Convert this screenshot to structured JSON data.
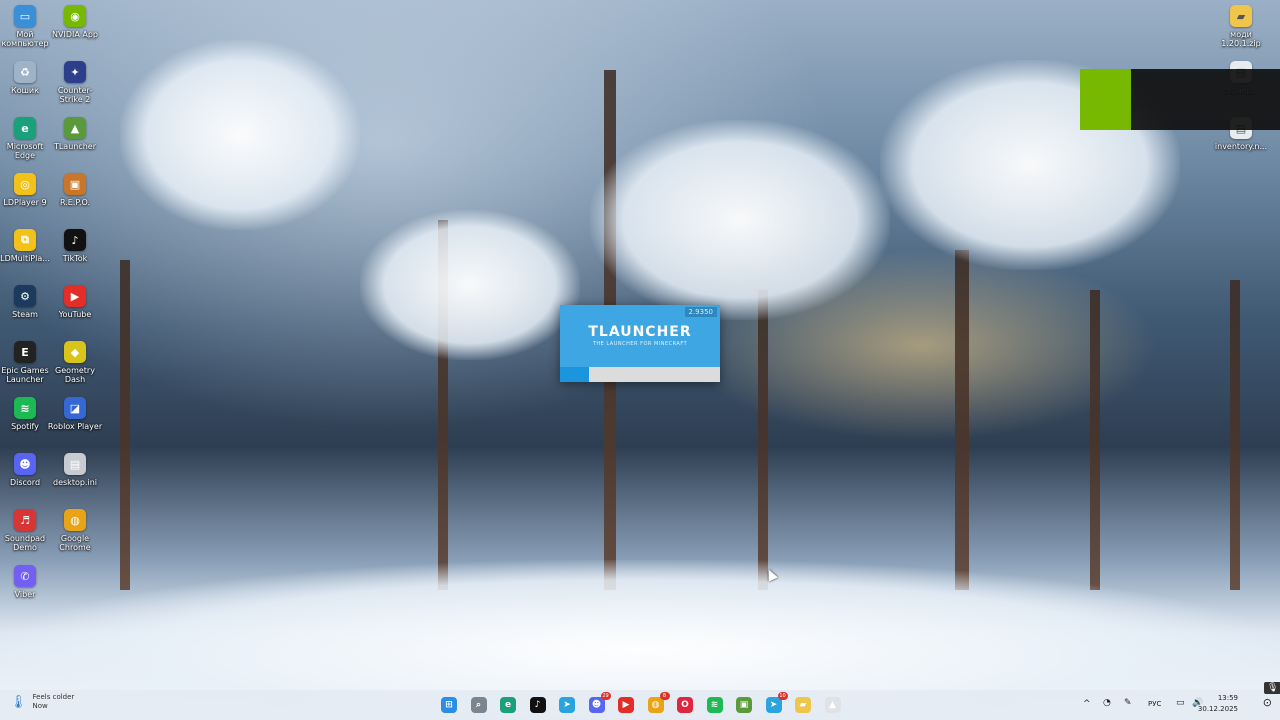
{
  "desktop_left": [
    {
      "label": "Мой компьютер",
      "icon": "computer-icon",
      "color": "#3a8fd9",
      "glyph": "▭"
    },
    {
      "label": "NVIDIA App",
      "icon": "nvidia-icon",
      "color": "#76b900",
      "glyph": "◉"
    },
    {
      "label": "Кошик",
      "icon": "recycle-bin-icon",
      "color": "#9fb3c8",
      "glyph": "♻"
    },
    {
      "label": "Counter-Strike 2",
      "icon": "counter-strike-icon",
      "color": "#2d3e8c",
      "glyph": "✦"
    },
    {
      "label": "Microsoft Edge",
      "icon": "edge-icon",
      "color": "#1aa179",
      "glyph": "e"
    },
    {
      "label": "TLauncher",
      "icon": "tlauncher-icon",
      "color": "#5a9a3a",
      "glyph": "▲"
    },
    {
      "label": "LDPlayer 9",
      "icon": "ldplayer-icon",
      "color": "#f2c21b",
      "glyph": "◎"
    },
    {
      "label": "R.E.P.O.",
      "icon": "repo-icon",
      "color": "#c9762a",
      "glyph": "▣"
    },
    {
      "label": "LDMultiPla...",
      "icon": "ldmultiplayer-icon",
      "color": "#f2c21b",
      "glyph": "⧉"
    },
    {
      "label": "TikTok",
      "icon": "tiktok-icon",
      "color": "#111111",
      "glyph": "♪"
    },
    {
      "label": "Steam",
      "icon": "steam-icon",
      "color": "#1b3a5c",
      "glyph": "⚙"
    },
    {
      "label": "YouTube",
      "icon": "youtube-icon",
      "color": "#e52d27",
      "glyph": "▶"
    },
    {
      "label": "Epic Games Launcher",
      "icon": "epic-games-icon",
      "color": "#222222",
      "glyph": "E"
    },
    {
      "label": "Geometry Dash",
      "icon": "geometry-dash-icon",
      "color": "#d8c41a",
      "glyph": "◆"
    },
    {
      "label": "Spotify",
      "icon": "spotify-icon",
      "color": "#1db954",
      "glyph": "≋"
    },
    {
      "label": "Roblox Player",
      "icon": "roblox-icon",
      "color": "#3568d4",
      "glyph": "◪"
    },
    {
      "label": "Discord",
      "icon": "discord-icon",
      "color": "#5865f2",
      "glyph": "☻"
    },
    {
      "label": "desktop.ini",
      "icon": "file-icon",
      "color": "#c8ccd2",
      "glyph": "▤"
    },
    {
      "label": "Soundpad Demo",
      "icon": "soundpad-icon",
      "color": "#d93535",
      "glyph": "♬"
    },
    {
      "label": "Google Chrome",
      "icon": "chrome-icon",
      "color": "#e8a317",
      "glyph": "◍"
    },
    {
      "label": "Viber",
      "icon": "viber-icon",
      "color": "#7360f2",
      "glyph": "✆"
    }
  ],
  "desktop_right": [
    {
      "label": "моди 1.20.1.zip",
      "icon": "zip-folder-icon",
      "color": "#f0c54b",
      "glyph": "▰"
    },
    {
      "label": "сервер...",
      "icon": "file-icon",
      "color": "#e9ecef",
      "glyph": "▤"
    },
    {
      "label": "inventory.n...",
      "icon": "file-icon",
      "color": "#e9ecef",
      "glyph": "▤"
    }
  ],
  "splash": {
    "version": "2.9350",
    "title": "TLAUNCHER",
    "subtitle": "THE LAUNCHER FOR MINECRAFT",
    "progress": 0.18,
    "bg_color": "#3da6e3"
  },
  "taskbar": {
    "weather": {
      "line1": "Feels colder",
      "line2": "Now"
    },
    "apps": [
      {
        "name": "start",
        "icon": "windows-start-icon",
        "color": "#2b8de3",
        "glyph": "⊞",
        "badge": ""
      },
      {
        "name": "search",
        "icon": "search-icon",
        "color": "#7a8590",
        "glyph": "⌕",
        "badge": ""
      },
      {
        "name": "edge",
        "icon": "edge-icon",
        "color": "#1aa179",
        "glyph": "e",
        "badge": ""
      },
      {
        "name": "tiktok",
        "icon": "tiktok-icon",
        "color": "#111111",
        "glyph": "♪",
        "badge": ""
      },
      {
        "name": "telegram",
        "icon": "telegram-icon",
        "color": "#2aa3e0",
        "glyph": "➤",
        "badge": ""
      },
      {
        "name": "discord",
        "icon": "discord-icon",
        "color": "#5865f2",
        "glyph": "☻",
        "badge": "29"
      },
      {
        "name": "youtube",
        "icon": "youtube-icon",
        "color": "#e52d27",
        "glyph": "▶",
        "badge": ""
      },
      {
        "name": "chrome",
        "icon": "chrome-icon",
        "color": "#e8a317",
        "glyph": "◍",
        "badge": "8"
      },
      {
        "name": "opera",
        "icon": "opera-icon",
        "color": "#e0263f",
        "glyph": "O",
        "badge": ""
      },
      {
        "name": "spotify",
        "icon": "spotify-icon",
        "color": "#1db954",
        "glyph": "≋",
        "badge": ""
      },
      {
        "name": "minecraft",
        "icon": "minecraft-icon",
        "color": "#5a9a3a",
        "glyph": "▣",
        "badge": ""
      },
      {
        "name": "telegram-2",
        "icon": "telegram-icon",
        "color": "#2aa3e0",
        "glyph": "➤",
        "badge": "10"
      },
      {
        "name": "file-explorer",
        "icon": "folder-icon",
        "color": "#f0c54b",
        "glyph": "▰",
        "badge": ""
      },
      {
        "name": "tlauncher",
        "icon": "tlauncher-icon",
        "color": "#dfe3e8",
        "glyph": "▲",
        "badge": ""
      }
    ],
    "language": "РУС",
    "time": "13:59",
    "date": "30.12.2025"
  }
}
